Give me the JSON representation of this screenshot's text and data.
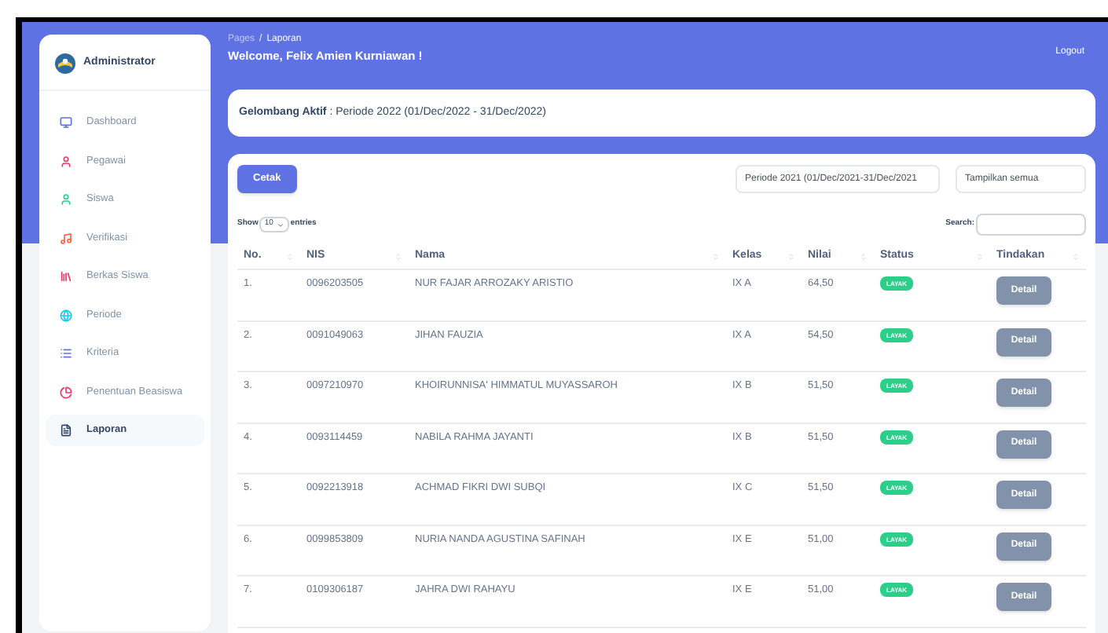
{
  "sidebar": {
    "brand": "Administrator",
    "items": [
      {
        "label": "Dashboard",
        "selected": false
      },
      {
        "label": "Pegawai",
        "selected": false
      },
      {
        "label": "Siswa",
        "selected": false
      },
      {
        "label": "Verifikasi",
        "selected": false
      },
      {
        "label": "Berkas Siswa",
        "selected": false
      },
      {
        "label": "Periode",
        "selected": false
      },
      {
        "label": "Kriteria",
        "selected": false
      },
      {
        "label": "Penentuan Beasiswa",
        "selected": false
      },
      {
        "label": "Laporan",
        "selected": true
      }
    ]
  },
  "header": {
    "breadcrumb_root": "Pages",
    "breadcrumb_separator": "/",
    "breadcrumb_current": "Laporan",
    "welcome": "Welcome, Felix Amien Kurniawan !",
    "logout": "Logout"
  },
  "active_wave": "**Gelombang Aktif** : Periode 2022 (01/Dec/2022 - 31/Dec/2022)",
  "toolbar": {
    "print_button": "Cetak",
    "period_select": "Periode 2021 (01/Dec/2021-31/Dec/2021",
    "filter_select": "Tampilkan semua"
  },
  "table_controls": {
    "show_label": "Show",
    "page_size": "10",
    "entries_label": "entries",
    "search_label": "Search:"
  },
  "table": {
    "columns": [
      "No.",
      "NIS",
      "Nama",
      "Kelas",
      "Nilai",
      "Status",
      "Tindakan"
    ],
    "rows": [
      {
        "no": "1.",
        "nis": "0096203505",
        "nama": "NUR FAJAR ARROZAKY ARISTIO",
        "kelas": "IX A",
        "nilai": "64,50",
        "status": "LAYAK",
        "action": "Detail"
      },
      {
        "no": "2.",
        "nis": "0091049063",
        "nama": "JIHAN FAUZIA",
        "kelas": "IX A",
        "nilai": "54,50",
        "status": "LAYAK",
        "action": "Detail"
      },
      {
        "no": "3.",
        "nis": "0097210970",
        "nama": "KHOIRUNNISA' HIMMATUL MUYASSAROH",
        "kelas": "IX B",
        "nilai": "51,50",
        "status": "LAYAK",
        "action": "Detail"
      },
      {
        "no": "4.",
        "nis": "0093114459",
        "nama": "NABILA RAHMA JAYANTI",
        "kelas": "IX B",
        "nilai": "51,50",
        "status": "LAYAK",
        "action": "Detail"
      },
      {
        "no": "5.",
        "nis": "0092213918",
        "nama": "ACHMAD FIKRI DWI SUBQI",
        "kelas": "IX C",
        "nilai": "51,50",
        "status": "LAYAK",
        "action": "Detail"
      },
      {
        "no": "6.",
        "nis": "0099853809",
        "nama": "NURIA NANDA AGUSTINA SAFINAH",
        "kelas": "IX E",
        "nilai": "51,00",
        "status": "LAYAK",
        "action": "Detail"
      },
      {
        "no": "7.",
        "nis": "0109306187",
        "nama": "JAHRA DWI RAHAYU",
        "kelas": "IX E",
        "nilai": "51,00",
        "status": "LAYAK",
        "action": "Detail"
      }
    ]
  }
}
